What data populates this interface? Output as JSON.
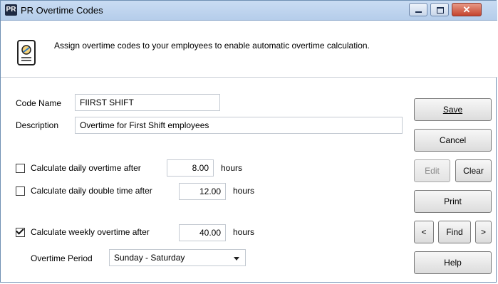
{
  "window": {
    "app_badge": "PR",
    "title": "PR Overtime Codes"
  },
  "banner": {
    "instruction": "Assign overtime codes to your employees to enable automatic overtime calculation."
  },
  "form": {
    "code_name_label": "Code Name",
    "code_name_value": "FIIRST SHIFT",
    "description_label": "Description",
    "description_value": "Overtime for First Shift employees",
    "daily_ot": {
      "checked": false,
      "label": "Calculate daily overtime after",
      "value": "8.00",
      "unit": "hours"
    },
    "daily_dt": {
      "checked": false,
      "label": "Calculate daily double time after",
      "value": "12.00",
      "unit": "hours"
    },
    "weekly_ot": {
      "checked": true,
      "label": "Calculate weekly overtime after",
      "value": "40.00",
      "unit": "hours"
    },
    "overtime_period_label": "Overtime Period",
    "overtime_period_value": "Sunday - Saturday"
  },
  "buttons": {
    "save": "Save",
    "cancel": "Cancel",
    "edit": "Edit",
    "clear": "Clear",
    "print": "Print",
    "prev": "<",
    "find": "Find",
    "next": ">",
    "help": "Help"
  },
  "icons": {
    "app": "pr-app-icon",
    "banner": "document-stamp-icon"
  }
}
